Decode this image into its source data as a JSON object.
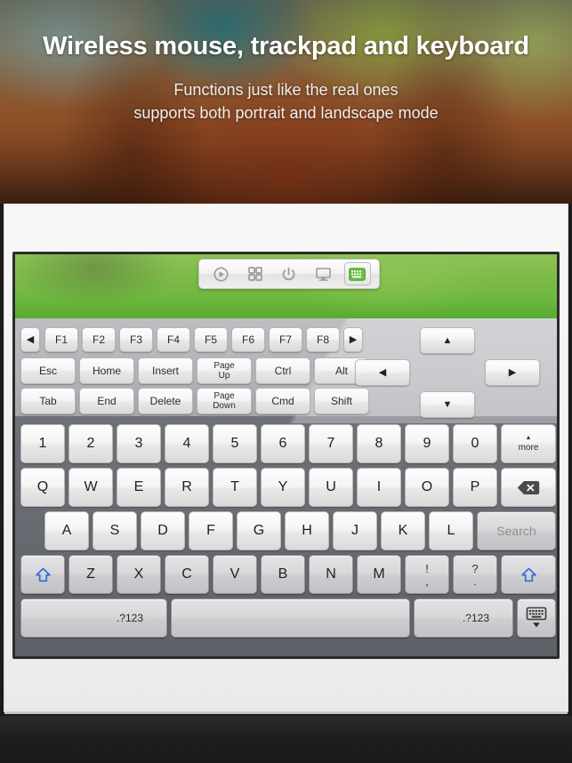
{
  "hero": {
    "title": "Wireless mouse, trackpad and keyboard",
    "subtitle_line1": "Functions just like the real ones",
    "subtitle_line2": "supports both portrait and landscape mode"
  },
  "toolbar": {
    "items": [
      {
        "name": "media-play-icon",
        "label": "Media"
      },
      {
        "name": "apps-grid-icon",
        "label": "Apps"
      },
      {
        "name": "power-icon",
        "label": "Power"
      },
      {
        "name": "display-icon",
        "label": "Display"
      },
      {
        "name": "keyboard-icon",
        "label": "Keyboard",
        "active": true
      }
    ]
  },
  "keyboard": {
    "fn_scroll_left": "◀",
    "fn_scroll_right": "▶",
    "function_keys": [
      "F1",
      "F2",
      "F3",
      "F4",
      "F5",
      "F6",
      "F7",
      "F8"
    ],
    "mod_row_1": [
      "Esc",
      "Home",
      "Insert",
      "Page\nUp",
      "Ctrl",
      "Alt"
    ],
    "mod_row_2": [
      "Tab",
      "End",
      "Delete",
      "Page\nDown",
      "Cmd",
      "Shift"
    ],
    "arrows": {
      "up": "▲",
      "down": "▼",
      "left": "◀",
      "right": "▶"
    },
    "number_row": [
      "1",
      "2",
      "3",
      "4",
      "5",
      "6",
      "7",
      "8",
      "9",
      "0"
    ],
    "more_key": {
      "arrow": "▲",
      "label": "more"
    },
    "qwerty_row": [
      "Q",
      "W",
      "E",
      "R",
      "T",
      "Y",
      "U",
      "I",
      "O",
      "P"
    ],
    "backspace": "backspace-icon",
    "asdf_row": [
      "A",
      "S",
      "D",
      "F",
      "G",
      "H",
      "J",
      "K",
      "L"
    ],
    "search_key": "Search",
    "zxcv_row": [
      "Z",
      "X",
      "C",
      "V",
      "B",
      "N",
      "M"
    ],
    "punct_keys": [
      {
        "top": "!",
        "bottom": ","
      },
      {
        "top": "?",
        "bottom": "."
      }
    ],
    "shift_left": "shift-icon",
    "shift_right": "shift-icon",
    "numeric_left": ".?123",
    "space": " ",
    "numeric_right": ".?123",
    "hide_keyboard": "hide-keyboard-icon"
  },
  "colors": {
    "screen_green": "#6db83e",
    "shift_blue": "#2f6ede",
    "bezel_white": "#f3f3f1",
    "keyboard_grey": "#696b72"
  }
}
